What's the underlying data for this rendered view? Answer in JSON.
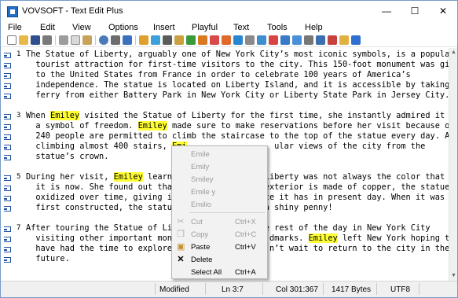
{
  "window": {
    "title": "VOVSOFT - Text Edit Plus",
    "minimize_glyph": "—",
    "maximize_glyph": "☐",
    "close_glyph": "✕"
  },
  "menu": [
    "File",
    "Edit",
    "View",
    "Options",
    "Insert",
    "Playful",
    "Text",
    "Tools",
    "Help"
  ],
  "toolbar_icons": [
    "new-file-icon",
    "open-folder-icon",
    "save-icon",
    "print-icon",
    "cut-icon",
    "copy-icon",
    "paste-icon",
    "find-icon",
    "replace-icon",
    "word-wrap-icon",
    "insert-icon",
    "image-icon",
    "calculator-icon",
    "lock-icon",
    "spellcheck-icon",
    "sort-icon",
    "color-icon",
    "brush-icon",
    "filter-icon",
    "list-icon",
    "remove-icon",
    "align-icon",
    "next-icon",
    "bookmark-icon",
    "hash-icon",
    "settings-icon",
    "calendar-icon",
    "clock-icon",
    "info-icon"
  ],
  "editor": {
    "paragraphs": [
      {
        "number": "1",
        "lines": [
          [
            {
              "t": "The Statue of Liberty, arguably one of New York City’s most iconic symbols, is a popular"
            }
          ],
          [
            {
              "t": "  tourist attraction for first-time visitors to the city. This 150-foot monument was gifted"
            }
          ],
          [
            {
              "t": "  to the United States from France in order to celebrate 100 years of America’s"
            }
          ],
          [
            {
              "t": "  independence. The statue is located on Liberty Island, and it is accessible by taking a"
            }
          ],
          [
            {
              "t": "  ferry from either Battery Park in New York City or Liberty State Park in Jersey City."
            }
          ]
        ]
      },
      {
        "number": "3",
        "lines": [
          [
            {
              "t": "When "
            },
            {
              "t": "Emiley",
              "h": true
            },
            {
              "t": " visited the Statue of Liberty for the first time, she instantly admired it as"
            }
          ],
          [
            {
              "t": "  a symbol of freedom. "
            },
            {
              "t": "Emiley",
              "h": true
            },
            {
              "t": " made sure to make reservations before her visit because only"
            }
          ],
          [
            {
              "t": "  240 people are permitted to climb the staircase to the top of the statue every day. After"
            }
          ],
          [
            {
              "t": "  climbing almost 400 stairs, "
            },
            {
              "t": "Emi",
              "h": true
            },
            {
              "t": "                  ular views of the city from the"
            }
          ],
          [
            {
              "t": "  statue’s crown."
            }
          ]
        ]
      },
      {
        "number": "5",
        "lines": [
          [
            {
              "t": "During her visit, "
            },
            {
              "t": "Emiley",
              "h": true
            },
            {
              "t": " learne                  Liberty was not always the color that"
            }
          ],
          [
            {
              "t": "  it is now. She found out that                  exterior is made of copper, the statue"
            }
          ],
          [
            {
              "t": "  oxidized over time, giving it                  ce it has in present day. When it was"
            }
          ],
          [
            {
              "t": "  first constructed, the statue                  a shiny penny!"
            }
          ]
        ]
      },
      {
        "number": "7",
        "lines": [
          [
            {
              "t": "After touring the Statue of Lib                  e rest of the day in New York City"
            }
          ],
          [
            {
              "t": "  visiting other important monum                  dmarks. "
            },
            {
              "t": "Emiley",
              "h": true
            },
            {
              "t": " left New York hoping to"
            }
          ],
          [
            {
              "t": "  have had the time to explore m                  n’t wait to return to the city in the"
            }
          ],
          [
            {
              "t": "  future."
            }
          ]
        ]
      }
    ]
  },
  "context_menu": {
    "suggestions": [
      "Emile",
      "Emily",
      "Smiley",
      "Emile y",
      "Emilio"
    ],
    "actions": [
      {
        "icon": "cut-icon",
        "label": "Cut",
        "shortcut": "Ctrl+X",
        "enabled": false
      },
      {
        "icon": "copy-icon",
        "label": "Copy",
        "shortcut": "Ctrl+C",
        "enabled": false
      },
      {
        "icon": "paste-icon",
        "label": "Paste",
        "shortcut": "Ctrl+V",
        "enabled": true
      },
      {
        "icon": "delete-icon",
        "label": "Delete",
        "shortcut": "",
        "enabled": true
      },
      {
        "icon": "",
        "label": "Select All",
        "shortcut": "Ctrl+A",
        "enabled": true
      }
    ]
  },
  "status": {
    "modified": "Modified",
    "position": "Ln 3:7",
    "column": "Col 301:367",
    "size": "1417 Bytes",
    "encoding": "UTF8"
  }
}
